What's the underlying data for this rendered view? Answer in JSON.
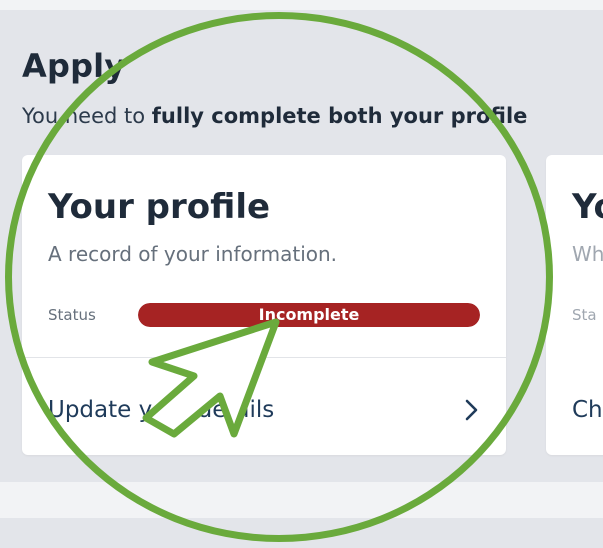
{
  "section": {
    "title": "Apply",
    "subtitle_prefix": "You need to ",
    "subtitle_bold": "fully complete both your profile"
  },
  "profile_card": {
    "title": "Your profile",
    "description": "A record of your information.",
    "status_label": "Status",
    "status_value": "Incomplete",
    "status_progress": 1.0,
    "status_color": "#a62323",
    "action_label": "Update your details",
    "chevron_icon": "chevron-right-icon"
  },
  "second_card": {
    "title": "Yo",
    "description": "Wh",
    "status_label": "Sta",
    "action_label": "Ch"
  },
  "overlay": {
    "circle_color": "#6aaa3c",
    "arrow_icon": "pointer-arrow-icon"
  }
}
